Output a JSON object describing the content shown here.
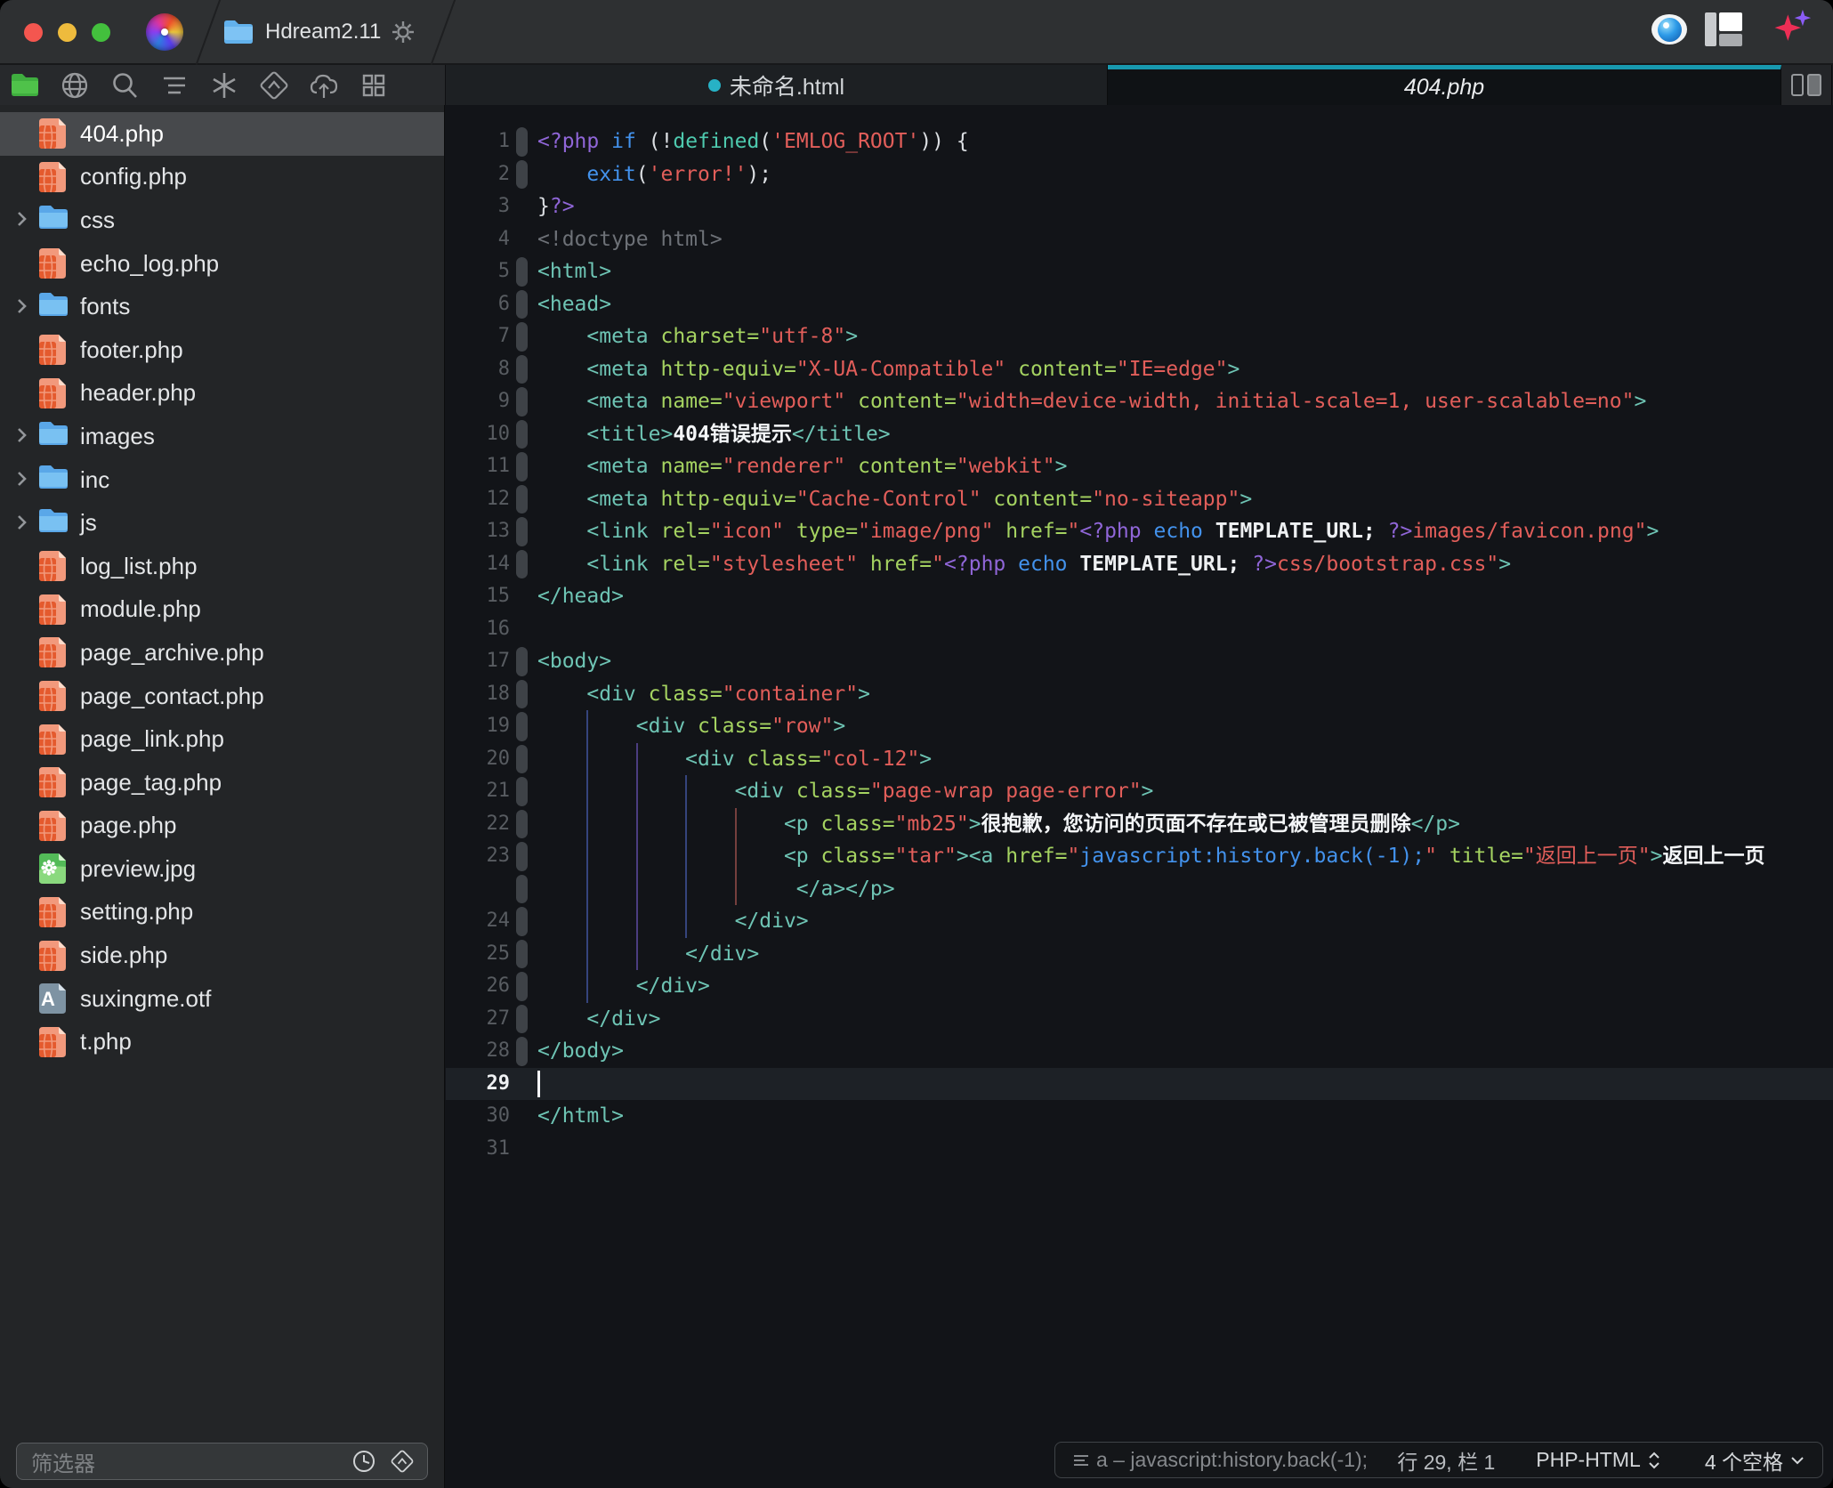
{
  "window": {
    "title": "Hdream2.11",
    "controls": [
      "close",
      "minimize",
      "zoom"
    ]
  },
  "colors": {
    "accent_teal": "#1899b0",
    "tab_modified_dot": "#27b2c6",
    "titlebar": "#2e3032",
    "sidebar_bg": "#232527",
    "editor_bg": "#121418",
    "selection_bg": "#47494c",
    "syntax": {
      "php_delimiter": "#9066d8",
      "keyword": "#4392ec",
      "function": "#4ec9ae",
      "string": "#e25e5a",
      "html_tag": "#6ec4b4",
      "attribute": "#a5d361",
      "plain": "#dcdfe3",
      "content_text": "#f4f6f8",
      "comment": "#6d7177"
    }
  },
  "toolbar": {
    "icons": [
      "files-folder",
      "globe",
      "search",
      "navigator-lines",
      "codesense-asterisk",
      "navigate-diamond",
      "publish-cloud",
      "workspace-grid"
    ]
  },
  "tabs": [
    {
      "label": "未命名.html",
      "modified": true,
      "active": false
    },
    {
      "label": "404.php",
      "modified": false,
      "active": true
    }
  ],
  "sidebar": {
    "files": [
      {
        "name": "404.php",
        "type": "php",
        "selected": true
      },
      {
        "name": "config.php",
        "type": "php"
      },
      {
        "name": "css",
        "type": "folder"
      },
      {
        "name": "echo_log.php",
        "type": "php"
      },
      {
        "name": "fonts",
        "type": "folder"
      },
      {
        "name": "footer.php",
        "type": "php"
      },
      {
        "name": "header.php",
        "type": "php"
      },
      {
        "name": "images",
        "type": "folder"
      },
      {
        "name": "inc",
        "type": "folder"
      },
      {
        "name": "js",
        "type": "folder"
      },
      {
        "name": "log_list.php",
        "type": "php"
      },
      {
        "name": "module.php",
        "type": "php"
      },
      {
        "name": "page_archive.php",
        "type": "php"
      },
      {
        "name": "page_contact.php",
        "type": "php"
      },
      {
        "name": "page_link.php",
        "type": "php"
      },
      {
        "name": "page_tag.php",
        "type": "php"
      },
      {
        "name": "page.php",
        "type": "php"
      },
      {
        "name": "preview.jpg",
        "type": "image"
      },
      {
        "name": "setting.php",
        "type": "php"
      },
      {
        "name": "side.php",
        "type": "php"
      },
      {
        "name": "suxingme.otf",
        "type": "font"
      },
      {
        "name": "t.php",
        "type": "php"
      }
    ],
    "filter_placeholder": "筛选器"
  },
  "editor": {
    "guide_colors": {
      "B": "#35447c",
      "V": "#4b3d80",
      "R": "#753f3d"
    },
    "lines": [
      {
        "n": 1,
        "fold": true,
        "tok": [
          [
            "php",
            "<?php"
          ],
          [
            "pl",
            " "
          ],
          [
            "kw",
            "if"
          ],
          [
            "pl",
            " (!"
          ],
          [
            "fn",
            "defined"
          ],
          [
            "pl",
            "("
          ],
          [
            "str",
            "'EMLOG_ROOT'"
          ],
          [
            "pl",
            ")) {"
          ]
        ]
      },
      {
        "n": 2,
        "fold": true,
        "tok": [
          [
            "pl",
            "    "
          ],
          [
            "kw",
            "exit"
          ],
          [
            "pl",
            "("
          ],
          [
            "str",
            "'error!'"
          ],
          [
            "pl",
            ");"
          ]
        ]
      },
      {
        "n": 3,
        "tok": [
          [
            "pl",
            "}"
          ],
          [
            "php",
            "?>"
          ]
        ]
      },
      {
        "n": 4,
        "tok": [
          [
            "cmt",
            "<!doctype html>"
          ]
        ]
      },
      {
        "n": 5,
        "fold": true,
        "tok": [
          [
            "tag",
            "<html>"
          ]
        ]
      },
      {
        "n": 6,
        "fold": true,
        "tok": [
          [
            "tag",
            "<head>"
          ]
        ]
      },
      {
        "n": 7,
        "fold": true,
        "tok": [
          [
            "pl",
            "    "
          ],
          [
            "tag",
            "<meta"
          ],
          [
            "pl",
            " "
          ],
          [
            "attr",
            "charset="
          ],
          [
            "str",
            "\"utf-8\""
          ],
          [
            "tag",
            ">"
          ]
        ]
      },
      {
        "n": 8,
        "fold": true,
        "tok": [
          [
            "pl",
            "    "
          ],
          [
            "tag",
            "<meta"
          ],
          [
            "pl",
            " "
          ],
          [
            "attr",
            "http-equiv="
          ],
          [
            "str",
            "\"X-UA-Compatible\""
          ],
          [
            "pl",
            " "
          ],
          [
            "attr",
            "content="
          ],
          [
            "str",
            "\"IE=edge\""
          ],
          [
            "tag",
            ">"
          ]
        ]
      },
      {
        "n": 9,
        "fold": true,
        "tok": [
          [
            "pl",
            "    "
          ],
          [
            "tag",
            "<meta"
          ],
          [
            "pl",
            " "
          ],
          [
            "attr",
            "name="
          ],
          [
            "str",
            "\"viewport\""
          ],
          [
            "pl",
            " "
          ],
          [
            "attr",
            "content="
          ],
          [
            "str",
            "\"width=device-width, initial-scale=1, user-scalable=no\""
          ],
          [
            "tag",
            ">"
          ]
        ]
      },
      {
        "n": 10,
        "fold": true,
        "tok": [
          [
            "pl",
            "    "
          ],
          [
            "tag",
            "<title>"
          ],
          [
            "txt",
            "404错误提示"
          ],
          [
            "tag",
            "</title>"
          ]
        ]
      },
      {
        "n": 11,
        "fold": true,
        "tok": [
          [
            "pl",
            "    "
          ],
          [
            "tag",
            "<meta"
          ],
          [
            "pl",
            " "
          ],
          [
            "attr",
            "name="
          ],
          [
            "str",
            "\"renderer\""
          ],
          [
            "pl",
            " "
          ],
          [
            "attr",
            "content="
          ],
          [
            "str",
            "\"webkit\""
          ],
          [
            "tag",
            ">"
          ]
        ]
      },
      {
        "n": 12,
        "fold": true,
        "tok": [
          [
            "pl",
            "    "
          ],
          [
            "tag",
            "<meta"
          ],
          [
            "pl",
            " "
          ],
          [
            "attr",
            "http-equiv="
          ],
          [
            "str",
            "\"Cache-Control\""
          ],
          [
            "pl",
            " "
          ],
          [
            "attr",
            "content="
          ],
          [
            "str",
            "\"no-siteapp\""
          ],
          [
            "tag",
            ">"
          ]
        ]
      },
      {
        "n": 13,
        "fold": true,
        "tok": [
          [
            "pl",
            "    "
          ],
          [
            "tag",
            "<link"
          ],
          [
            "pl",
            " "
          ],
          [
            "attr",
            "rel="
          ],
          [
            "str",
            "\"icon\""
          ],
          [
            "pl",
            " "
          ],
          [
            "attr",
            "type="
          ],
          [
            "str",
            "\"image/png\""
          ],
          [
            "pl",
            " "
          ],
          [
            "attr",
            "href="
          ],
          [
            "str",
            "\""
          ],
          [
            "php",
            "<?php"
          ],
          [
            "pl",
            " "
          ],
          [
            "kw",
            "echo"
          ],
          [
            "pl",
            " "
          ],
          [
            "cst",
            "TEMPLATE_URL;"
          ],
          [
            "pl",
            " "
          ],
          [
            "php",
            "?>"
          ],
          [
            "str",
            "images/favicon.png\""
          ],
          [
            "tag",
            ">"
          ]
        ]
      },
      {
        "n": 14,
        "fold": true,
        "tok": [
          [
            "pl",
            "    "
          ],
          [
            "tag",
            "<link"
          ],
          [
            "pl",
            " "
          ],
          [
            "attr",
            "rel="
          ],
          [
            "str",
            "\"stylesheet\""
          ],
          [
            "pl",
            " "
          ],
          [
            "attr",
            "href="
          ],
          [
            "str",
            "\""
          ],
          [
            "php",
            "<?php"
          ],
          [
            "pl",
            " "
          ],
          [
            "kw",
            "echo"
          ],
          [
            "pl",
            " "
          ],
          [
            "cst",
            "TEMPLATE_URL;"
          ],
          [
            "pl",
            " "
          ],
          [
            "php",
            "?>"
          ],
          [
            "str",
            "css/bootstrap.css\""
          ],
          [
            "tag",
            ">"
          ]
        ]
      },
      {
        "n": 15,
        "tok": [
          [
            "tag",
            "</head>"
          ]
        ]
      },
      {
        "n": 16,
        "tok": []
      },
      {
        "n": 17,
        "fold": true,
        "tok": [
          [
            "tag",
            "<body>"
          ]
        ]
      },
      {
        "n": 18,
        "fold": true,
        "tok": [
          [
            "pl",
            "    "
          ],
          [
            "tag",
            "<div"
          ],
          [
            "pl",
            " "
          ],
          [
            "attr",
            "class="
          ],
          [
            "str",
            "\"container\""
          ],
          [
            "tag",
            ">"
          ]
        ]
      },
      {
        "n": 19,
        "fold": true,
        "guides": [
          [
            4,
            "B"
          ]
        ],
        "tok": [
          [
            "pl",
            "        "
          ],
          [
            "tag",
            "<div"
          ],
          [
            "pl",
            " "
          ],
          [
            "attr",
            "class="
          ],
          [
            "str",
            "\"row\""
          ],
          [
            "tag",
            ">"
          ]
        ]
      },
      {
        "n": 20,
        "fold": true,
        "guides": [
          [
            4,
            "B"
          ],
          [
            8,
            "V"
          ]
        ],
        "tok": [
          [
            "pl",
            "            "
          ],
          [
            "tag",
            "<div"
          ],
          [
            "pl",
            " "
          ],
          [
            "attr",
            "class="
          ],
          [
            "str",
            "\"col-12\""
          ],
          [
            "tag",
            ">"
          ]
        ]
      },
      {
        "n": 21,
        "fold": true,
        "guides": [
          [
            4,
            "B"
          ],
          [
            8,
            "V"
          ],
          [
            12,
            "B"
          ]
        ],
        "tok": [
          [
            "pl",
            "                "
          ],
          [
            "tag",
            "<div"
          ],
          [
            "pl",
            " "
          ],
          [
            "attr",
            "class="
          ],
          [
            "str",
            "\"page-wrap page-error\""
          ],
          [
            "tag",
            ">"
          ]
        ]
      },
      {
        "n": 22,
        "fold": true,
        "guides": [
          [
            4,
            "B"
          ],
          [
            8,
            "V"
          ],
          [
            12,
            "B"
          ],
          [
            16,
            "R"
          ]
        ],
        "tok": [
          [
            "pl",
            "                    "
          ],
          [
            "tag",
            "<p"
          ],
          [
            "pl",
            " "
          ],
          [
            "attr",
            "class="
          ],
          [
            "str",
            "\"mb25\""
          ],
          [
            "tag",
            ">"
          ],
          [
            "txt",
            "很抱歉，您访问的页面不存在或已被管理员删除"
          ],
          [
            "tag",
            "</p>"
          ]
        ]
      },
      {
        "n": 23,
        "fold": true,
        "guides": [
          [
            4,
            "B"
          ],
          [
            8,
            "V"
          ],
          [
            12,
            "B"
          ],
          [
            16,
            "R"
          ]
        ],
        "tok": [
          [
            "pl",
            "                    "
          ],
          [
            "tag",
            "<p"
          ],
          [
            "pl",
            " "
          ],
          [
            "attr",
            "class="
          ],
          [
            "str",
            "\"tar\""
          ],
          [
            "tag",
            "><a"
          ],
          [
            "pl",
            " "
          ],
          [
            "attr",
            "href="
          ],
          [
            "str",
            "\""
          ],
          [
            "kw",
            "javascript:history.back(-1);"
          ],
          [
            "str",
            "\""
          ],
          [
            "pl",
            " "
          ],
          [
            "attr",
            "title="
          ],
          [
            "str",
            "\"返回上一页\""
          ],
          [
            "tag",
            ">"
          ],
          [
            "txt",
            "返回上一页"
          ]
        ]
      },
      {
        "n": null,
        "wrap": true,
        "fold": true,
        "guides": [
          [
            4,
            "B"
          ],
          [
            8,
            "V"
          ],
          [
            12,
            "B"
          ],
          [
            16,
            "R"
          ]
        ],
        "tok": [
          [
            "pl",
            "                     "
          ],
          [
            "tag",
            "</a></p>"
          ]
        ]
      },
      {
        "n": 24,
        "fold": true,
        "guides": [
          [
            4,
            "B"
          ],
          [
            8,
            "V"
          ],
          [
            12,
            "B"
          ]
        ],
        "tok": [
          [
            "pl",
            "                "
          ],
          [
            "tag",
            "</div>"
          ]
        ]
      },
      {
        "n": 25,
        "fold": true,
        "guides": [
          [
            4,
            "B"
          ],
          [
            8,
            "V"
          ]
        ],
        "tok": [
          [
            "pl",
            "            "
          ],
          [
            "tag",
            "</div>"
          ]
        ]
      },
      {
        "n": 26,
        "fold": true,
        "guides": [
          [
            4,
            "B"
          ]
        ],
        "tok": [
          [
            "pl",
            "        "
          ],
          [
            "tag",
            "</div>"
          ]
        ]
      },
      {
        "n": 27,
        "fold": true,
        "tok": [
          [
            "pl",
            "    "
          ],
          [
            "tag",
            "</div>"
          ]
        ]
      },
      {
        "n": 28,
        "fold": true,
        "tok": [
          [
            "tag",
            "</body>"
          ]
        ]
      },
      {
        "n": 29,
        "current": true,
        "cursor": true,
        "tok": []
      },
      {
        "n": 30,
        "tok": [
          [
            "tag",
            "</html>"
          ]
        ]
      },
      {
        "n": 31,
        "tok": []
      }
    ]
  },
  "statusbar": {
    "context": "a – javascript:history.back(-1);",
    "position": "行 29, 栏 1",
    "language": "PHP-HTML",
    "indent": "4 个空格"
  }
}
